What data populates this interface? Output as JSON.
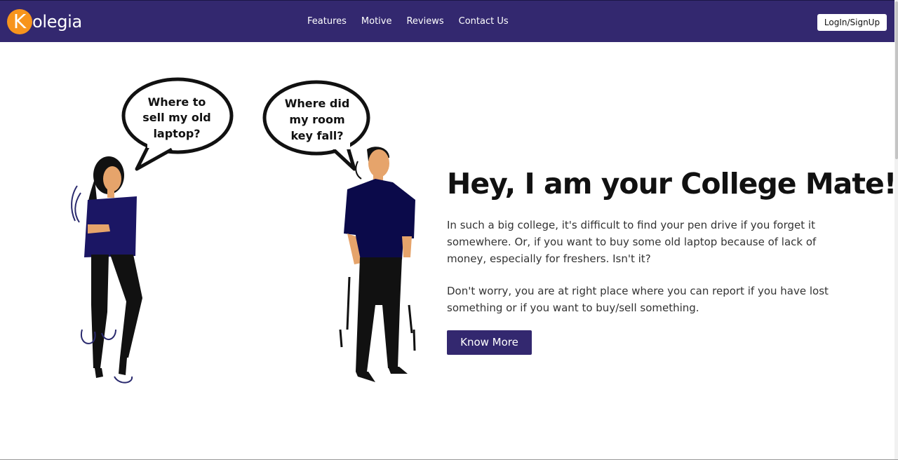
{
  "brand": {
    "logo_letter": "K",
    "name": "olegia",
    "logo_color": "#f7941d",
    "nav_bg": "#33286f"
  },
  "nav": {
    "links": [
      "Features",
      "Motive",
      "Reviews",
      "Contact Us"
    ],
    "login_label": "LogIn/SignUp"
  },
  "illustration": {
    "bubble_left": [
      "Where to",
      "sell my old",
      "laptop?"
    ],
    "bubble_right": [
      "Where did",
      "my room",
      "key fall?"
    ]
  },
  "hero": {
    "title": "Hey, I am your College Mate!",
    "paragraph1": "In such a big college, it's difficult to find your pen drive if you forget it somewhere. Or, if you want to buy some old laptop because of lack of money, especially for freshers. Isn't it?",
    "paragraph2": "Don't worry, you are at right place where you can report if you have lost something or if you want to buy/sell something.",
    "button_label": "Know More"
  }
}
